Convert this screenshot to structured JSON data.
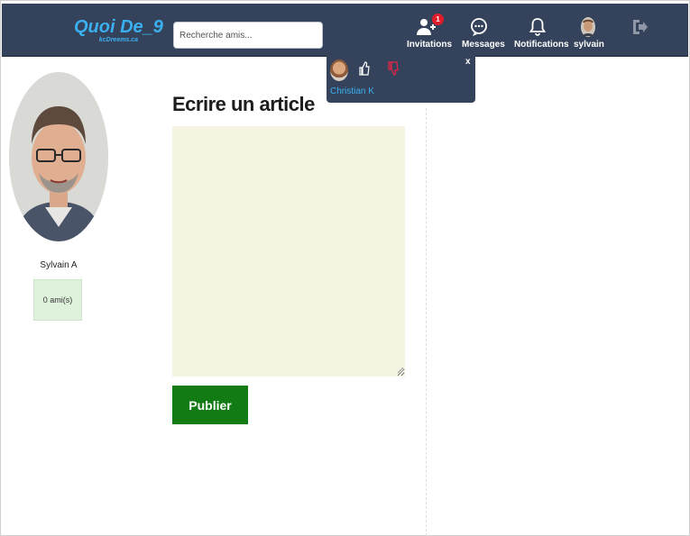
{
  "header": {
    "logo_title": "Quoi De_9",
    "logo_subtitle": "kcDreems.ca",
    "search": {
      "placeholder": "Recherche amis..."
    },
    "nav": {
      "invitations": {
        "label": "Invitations",
        "badge": "1"
      },
      "messages": {
        "label": "Messages"
      },
      "notifications": {
        "label": "Notifications"
      },
      "profile": {
        "label": "sylvain"
      }
    }
  },
  "invitation_dropdown": {
    "close_label": "x",
    "sender_name": "Christian K"
  },
  "profile": {
    "name": "Sylvain A",
    "friends": "0 ami(s)"
  },
  "main": {
    "title": "Ecrire un article",
    "publish_label": "Publier"
  },
  "colors": {
    "topbar": "#34435b",
    "accent": "#3bb0f0",
    "publish": "#137b13",
    "editor": "#f5f3e2",
    "badge": "#e11d2b"
  }
}
